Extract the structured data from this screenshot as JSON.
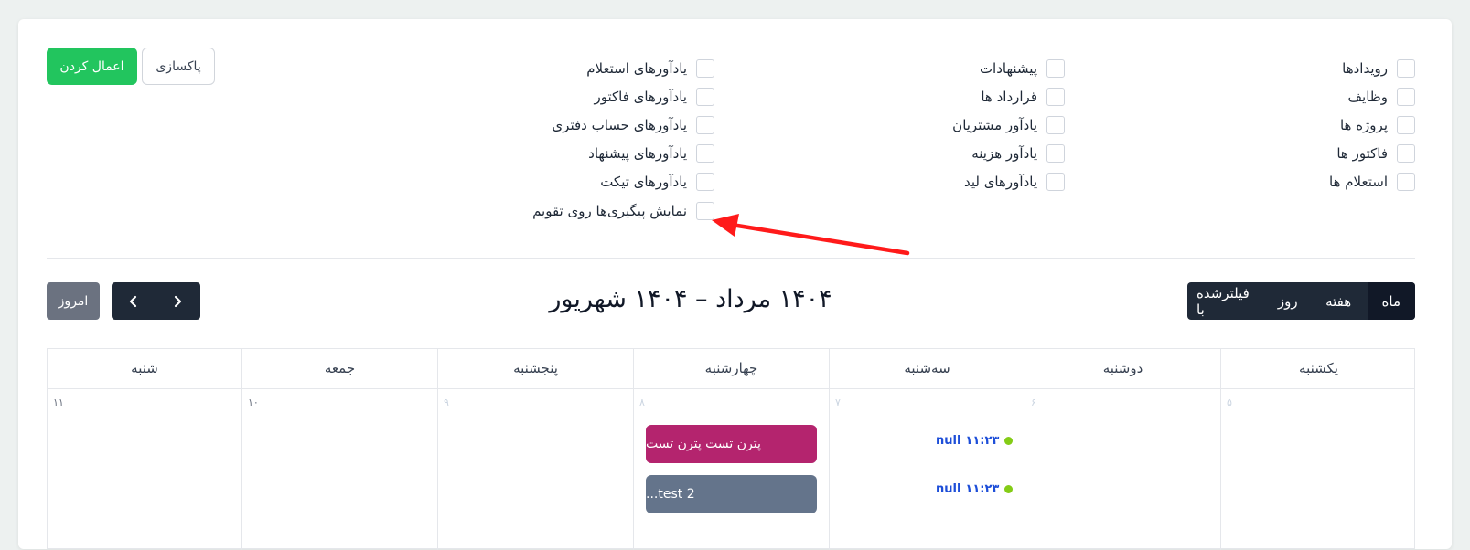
{
  "filters": {
    "col1": [
      "رویدادها",
      "وظایف",
      "پروژه ها",
      "فاکتور ها",
      "استعلام ها"
    ],
    "col2": [
      "پیشنهادات",
      "قرارداد ها",
      "یادآور مشتریان",
      "یادآور هزینه",
      "یادآورهای لید"
    ],
    "col3": [
      "یادآورهای استعلام",
      "یادآورهای فاکتور",
      "یادآورهای حساب دفتری",
      "یادآورهای پیشنهاد",
      "یادآورهای تیکت",
      "نمایش پیگیری‌ها روی تقویم"
    ]
  },
  "actions": {
    "apply_label": "اعمال کردن",
    "clear_label": "پاکسازی"
  },
  "toolbar": {
    "today_label": "امروز",
    "title": "۱۴۰۴ مرداد – ۱۴۰۴ شهریور",
    "views": [
      "ماه",
      "هفته",
      "روز",
      "فیلترشده با"
    ],
    "active_view": "ماه"
  },
  "calendar": {
    "weekdays": [
      "یکشنبه",
      "دوشنبه",
      "سه‌شنبه",
      "چهارشنبه",
      "پنجشنبه",
      "جمعه",
      "شنبه"
    ],
    "day_numbers": [
      "۵",
      "۶",
      "۷",
      "۸",
      "۹",
      "۱۰",
      "۱۱"
    ],
    "events": {
      "dot_events": [
        {
          "time": "۱۱:۲۳",
          "title": "null"
        },
        {
          "time": "۱۱:۲۳",
          "title": "null"
        }
      ],
      "block_events": [
        {
          "title": "پترن تست پترن تست",
          "color": "#b4246e"
        },
        {
          "title": "test 2...",
          "color": "#64748b"
        }
      ]
    }
  },
  "colors": {
    "accent_green": "#22c55e",
    "dark": "#1f2937",
    "arrow": "#ff1a1a"
  }
}
